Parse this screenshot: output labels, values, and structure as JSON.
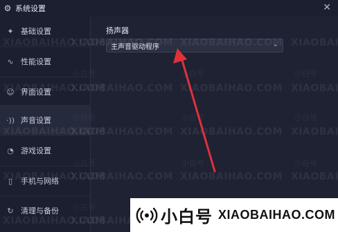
{
  "window": {
    "title": "系统设置",
    "close_glyph": "✕",
    "gear_glyph": "⚙"
  },
  "sidebar": {
    "items": [
      {
        "label": "基础设置",
        "icon": "✦",
        "icon_name": "gear-icon"
      },
      {
        "label": "性能设置",
        "icon": "∿",
        "icon_name": "pulse-icon"
      },
      {
        "label": "界面设置",
        "icon": "☺",
        "icon_name": "palette-icon"
      },
      {
        "label": "声音设置",
        "icon": "·))",
        "icon_name": "sound-icon",
        "active": true
      },
      {
        "label": "游戏设置",
        "icon": "◔",
        "icon_name": "game-icon"
      },
      {
        "label": "手机与网络",
        "icon": "▯",
        "icon_name": "phone-icon"
      },
      {
        "label": "清理与备份",
        "icon": "↻",
        "icon_name": "cleanup-icon"
      }
    ]
  },
  "speaker": {
    "label": "扬声器",
    "selected": "主声音驱动程序",
    "chevron": "⌄"
  },
  "watermark": {
    "domain": "XIAOBAIHAO.COM",
    "brand": "小白号"
  },
  "banner": {
    "brand_cn": "小白号",
    "domain": "XIAOBAIHAO.COM"
  },
  "colors": {
    "background": "#1e2233",
    "sidebar": "#1b1f30",
    "active_item": "#252a3d",
    "arrow": "#e0313a"
  }
}
